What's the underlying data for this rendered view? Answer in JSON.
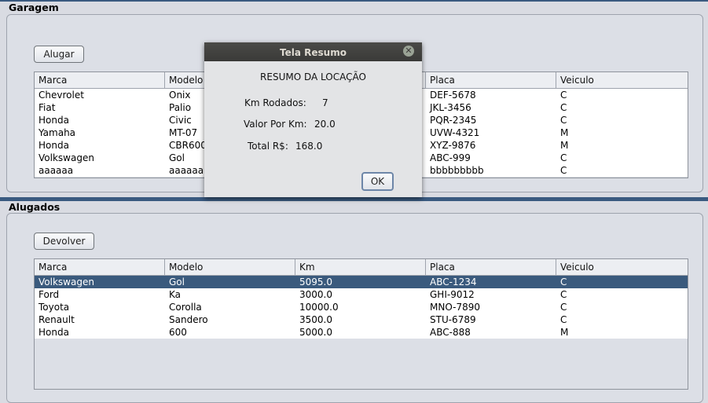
{
  "garagem": {
    "title": "Garagem",
    "button": "Alugar",
    "columns": [
      "Marca",
      "Modelo",
      "",
      "Placa",
      "Veiculo"
    ],
    "rows": [
      [
        "Chevrolet",
        "Onix",
        "",
        "DEF-5678",
        "C"
      ],
      [
        "Fiat",
        "Palio",
        "",
        "JKL-3456",
        "C"
      ],
      [
        "Honda",
        "Civic",
        "",
        "PQR-2345",
        "C"
      ],
      [
        "Yamaha",
        "MT-07",
        "",
        "UVW-4321",
        "M"
      ],
      [
        "Honda",
        "CBR600",
        "",
        "XYZ-9876",
        "M"
      ],
      [
        "Volkswagen",
        "Gol",
        "",
        "ABC-999",
        "C"
      ],
      [
        "aaaaaa",
        "aaaaaa",
        "",
        "bbbbbbbbb",
        "C"
      ]
    ]
  },
  "alugados": {
    "title": "Alugados",
    "button": "Devolver",
    "columns": [
      "Marca",
      "Modelo",
      "Km",
      "Placa",
      "Veiculo"
    ],
    "selected_row": 0,
    "rows": [
      [
        "Volkswagen",
        "Gol",
        "5095.0",
        "ABC-1234",
        "C"
      ],
      [
        "Ford",
        "Ka",
        "3000.0",
        "GHI-9012",
        "C"
      ],
      [
        "Toyota",
        "Corolla",
        "10000.0",
        "MNO-7890",
        "C"
      ],
      [
        "Renault",
        "Sandero",
        "3500.0",
        "STU-6789",
        "C"
      ],
      [
        "Honda",
        "600",
        "5000.0",
        "ABC-888",
        "M"
      ]
    ]
  },
  "dialog": {
    "title": "Tela Resumo",
    "close_icon": "close-icon",
    "heading": "RESUMO DA LOCAÇÃO",
    "km_label": "Km Rodados:",
    "km_value": "7",
    "valor_label": "Valor Por Km:",
    "valor_value": "20.0",
    "total_label": "Total R$:",
    "total_value": "168.0",
    "ok_label": "OK"
  },
  "colors": {
    "selection": "#3a5a7d",
    "accent_bar": "#3a5a80",
    "dialog_titlebar": "#3c3c3a"
  }
}
